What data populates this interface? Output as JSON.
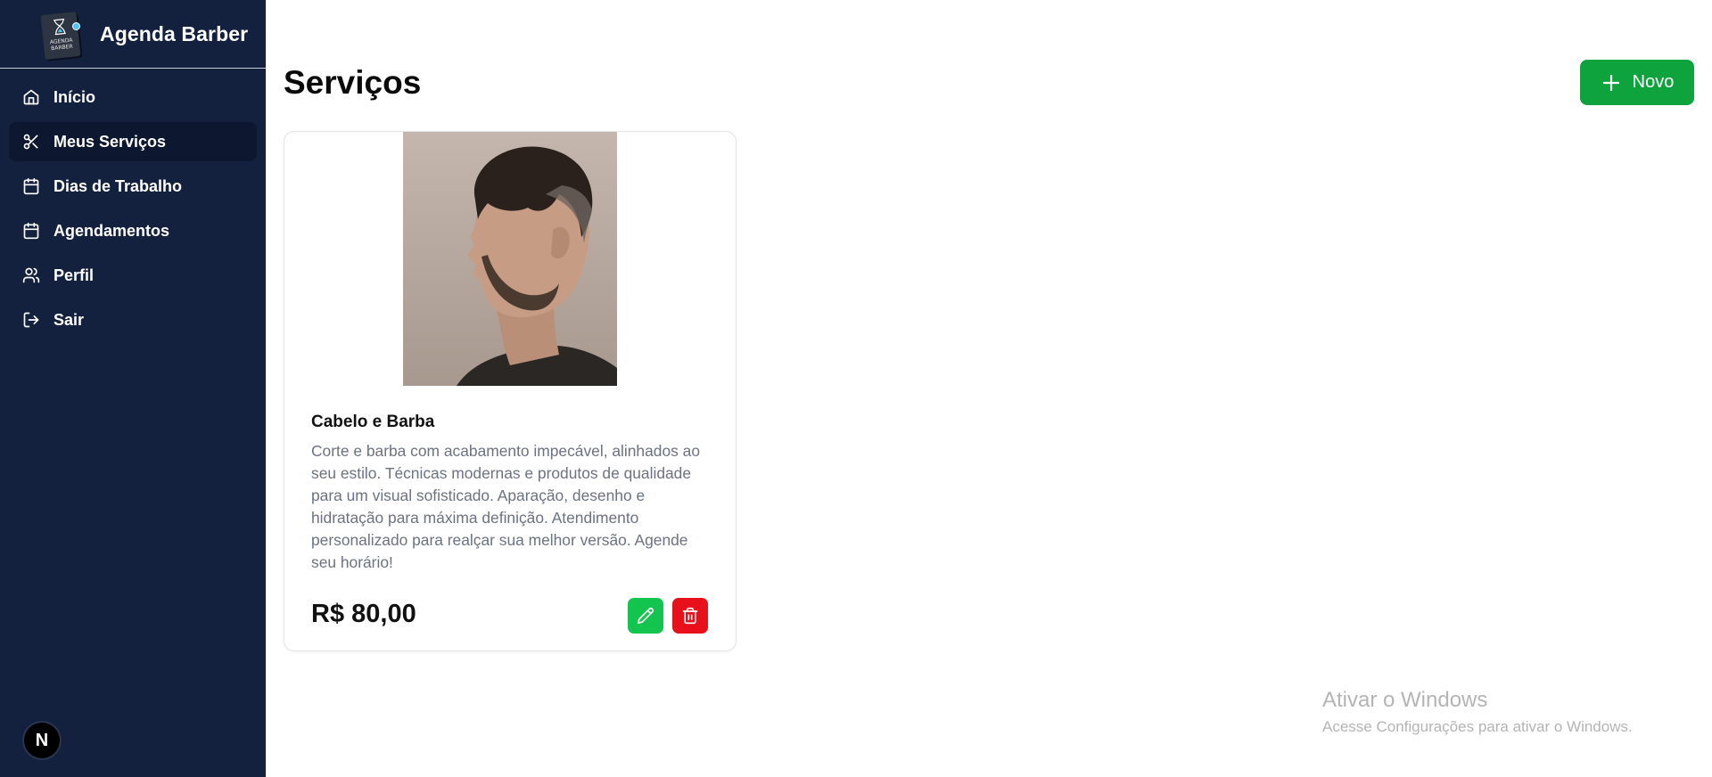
{
  "app": {
    "title": "Agenda Barber",
    "logo_text": "AGENDA BARBER"
  },
  "sidebar": {
    "items": [
      {
        "label": "Início",
        "icon": "home-icon",
        "active": false
      },
      {
        "label": "Meus Serviços",
        "icon": "scissors-icon",
        "active": true
      },
      {
        "label": "Dias de Trabalho",
        "icon": "calendar-icon",
        "active": false
      },
      {
        "label": "Agendamentos",
        "icon": "calendar-icon",
        "active": false
      },
      {
        "label": "Perfil",
        "icon": "users-icon",
        "active": false
      },
      {
        "label": "Sair",
        "icon": "logout-icon",
        "active": false
      }
    ],
    "badge": "N"
  },
  "main": {
    "title": "Serviços",
    "new_button": "Novo",
    "services": [
      {
        "name": "Cabelo e Barba",
        "description": "Corte e barba com acabamento impecável, alinhados ao seu estilo. Técnicas modernas e produtos de qualidade para um visual sofisticado. Aparação, desenho e hidratação para máxima definição. Atendimento personalizado para realçar sua melhor versão. Agende seu horário!",
        "price": "R$ 80,00",
        "image": "man-profile-haircut-photo"
      }
    ]
  },
  "watermark": {
    "line1": "Ativar o Windows",
    "line2": "Acesse Configurações para ativar o Windows."
  },
  "colors": {
    "sidebar_bg": "#13213f",
    "primary_green": "#0fa33e",
    "edit_green": "#13c44e",
    "delete_red": "#e8111b"
  }
}
